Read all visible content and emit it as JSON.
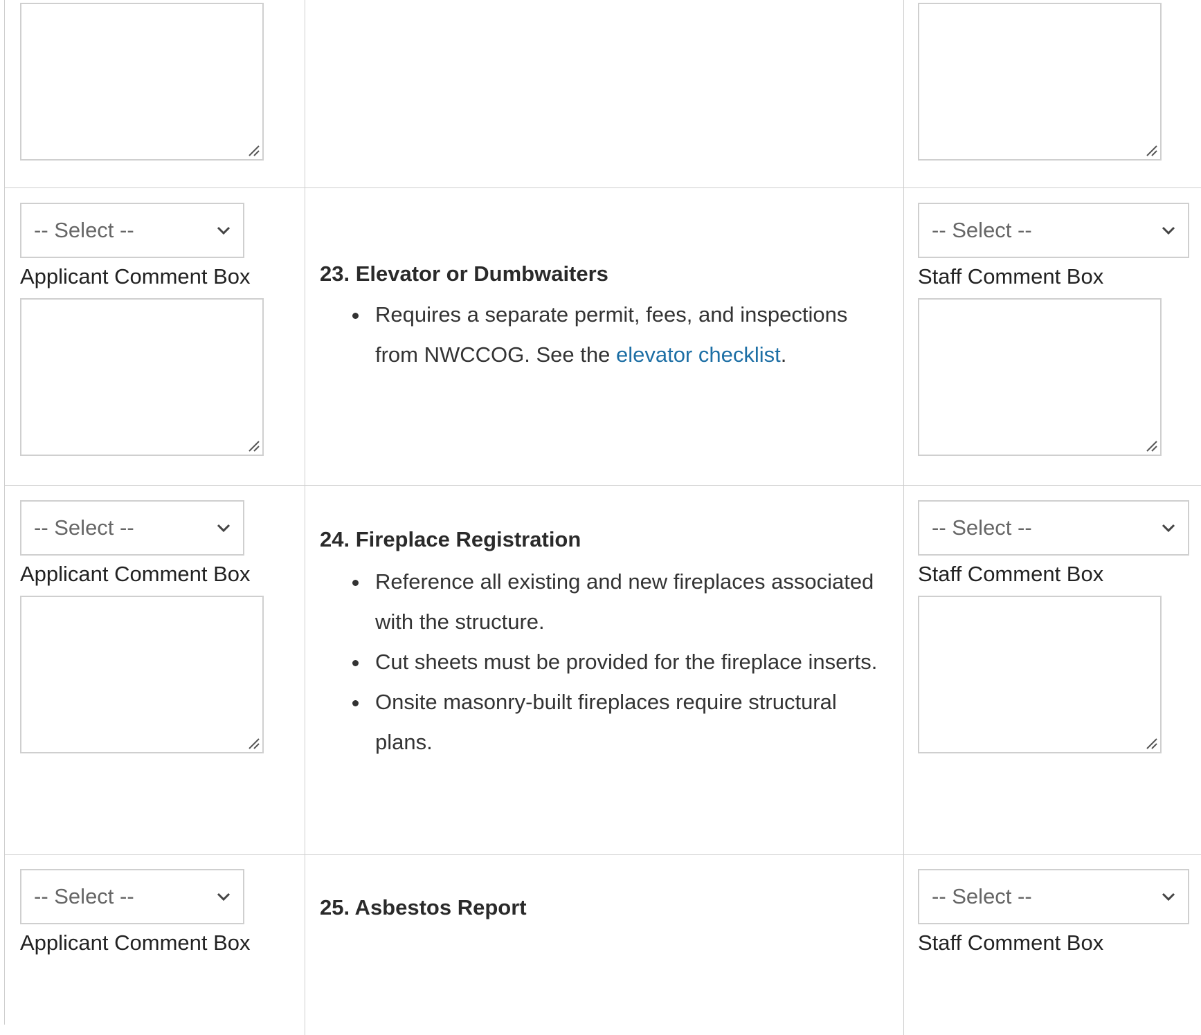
{
  "select_placeholder": "-- Select --",
  "applicant_label": "Applicant Comment Box",
  "staff_label": "Staff Comment Box",
  "items": [
    {
      "heading": "23. Elevator or Dumbwaiters",
      "bullet_text_before": "Requires a separate permit, fees, and inspections from NWCCOG. See the ",
      "bullet_link": "elevator checklist",
      "bullet_text_after": "."
    },
    {
      "heading": "24. Fireplace Registration",
      "bullets": [
        "Reference all existing and new fireplaces associated with the structure.",
        "Cut sheets must be provided for the fireplace inserts.",
        "Onsite masonry-built fireplaces require structural plans."
      ]
    },
    {
      "heading": "25. Asbestos Report"
    }
  ],
  "colors": {
    "border": "#cfcfcf",
    "link": "#1d6fa5",
    "text": "#222222",
    "placeholder": "#666666"
  }
}
